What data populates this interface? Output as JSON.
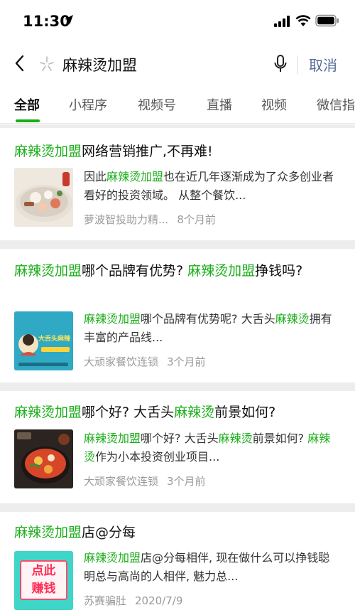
{
  "status_bar": {
    "time": "11:30",
    "icons": [
      "location-arrow-icon",
      "signal-icon",
      "wifi-icon",
      "battery-icon"
    ]
  },
  "search": {
    "query": "麻辣烫加盟",
    "cancel_label": "取消",
    "icons": [
      "back-icon",
      "sparkle-icon",
      "microphone-icon"
    ]
  },
  "tabs": [
    "全部",
    "小程序",
    "视频号",
    "直播",
    "视频",
    "微信指数"
  ],
  "active_tab": "全部",
  "colors": {
    "highlight": "#1aad19",
    "link": "#576b95",
    "meta": "#9a9a9a"
  },
  "results": [
    {
      "title": [
        {
          "text": "麻辣烫加盟",
          "hl": true
        },
        {
          "text": "网络营销推广,不再难!",
          "hl": false
        }
      ],
      "snippet": [
        {
          "text": "因此",
          "hl": false
        },
        {
          "text": "麻辣烫加盟",
          "hl": true
        },
        {
          "text": "也在近几年逐渐成为了众多创业者看好的投资领域。 从整个餐饮...",
          "hl": false
        }
      ],
      "source": "萝波智投助力精...",
      "time": "8个月前",
      "thumb": "hotpot-photo"
    },
    {
      "title": [
        {
          "text": "麻辣烫加盟",
          "hl": true
        },
        {
          "text": "哪个品牌有优势? ",
          "hl": false
        },
        {
          "text": "麻辣烫加盟",
          "hl": true
        },
        {
          "text": "挣钱吗?",
          "hl": false
        }
      ],
      "snippet": [
        {
          "text": "麻辣烫加盟",
          "hl": true
        },
        {
          "text": "哪个品牌有优势呢? 大舌头",
          "hl": false
        },
        {
          "text": "麻辣烫",
          "hl": true
        },
        {
          "text": "拥有丰富的产品线...",
          "hl": false
        }
      ],
      "source": "大顽家餐饮连锁",
      "time": "3个月前",
      "thumb": "poster",
      "thumb_text": "大舌头麻辣"
    },
    {
      "title": [
        {
          "text": "麻辣烫加盟",
          "hl": true
        },
        {
          "text": "哪个好? 大舌头",
          "hl": false
        },
        {
          "text": "麻辣烫",
          "hl": true
        },
        {
          "text": "前景如何?",
          "hl": false
        }
      ],
      "snippet": [
        {
          "text": "麻辣烫加盟",
          "hl": true
        },
        {
          "text": "哪个好? 大舌头",
          "hl": false
        },
        {
          "text": "麻辣烫",
          "hl": true
        },
        {
          "text": "前景如何? ",
          "hl": false
        },
        {
          "text": "麻辣烫",
          "hl": true
        },
        {
          "text": "作为小本投资创业项目...",
          "hl": false
        }
      ],
      "source": "大顽家餐饮连锁",
      "time": "3个月前",
      "thumb": "bowl-photo"
    },
    {
      "title": [
        {
          "text": "麻辣烫加盟",
          "hl": true
        },
        {
          "text": "店@分每",
          "hl": false
        }
      ],
      "snippet": [
        {
          "text": "麻辣烫加盟",
          "hl": true
        },
        {
          "text": "店@分每相伴, 现在做什么可以挣钱聪明总与高尚的人相伴, 魅力总...",
          "hl": false
        }
      ],
      "source": "苏赛骗肚",
      "time": "2020/7/9",
      "thumb": "badge",
      "thumb_lines": [
        "点此",
        "赚钱"
      ]
    }
  ]
}
